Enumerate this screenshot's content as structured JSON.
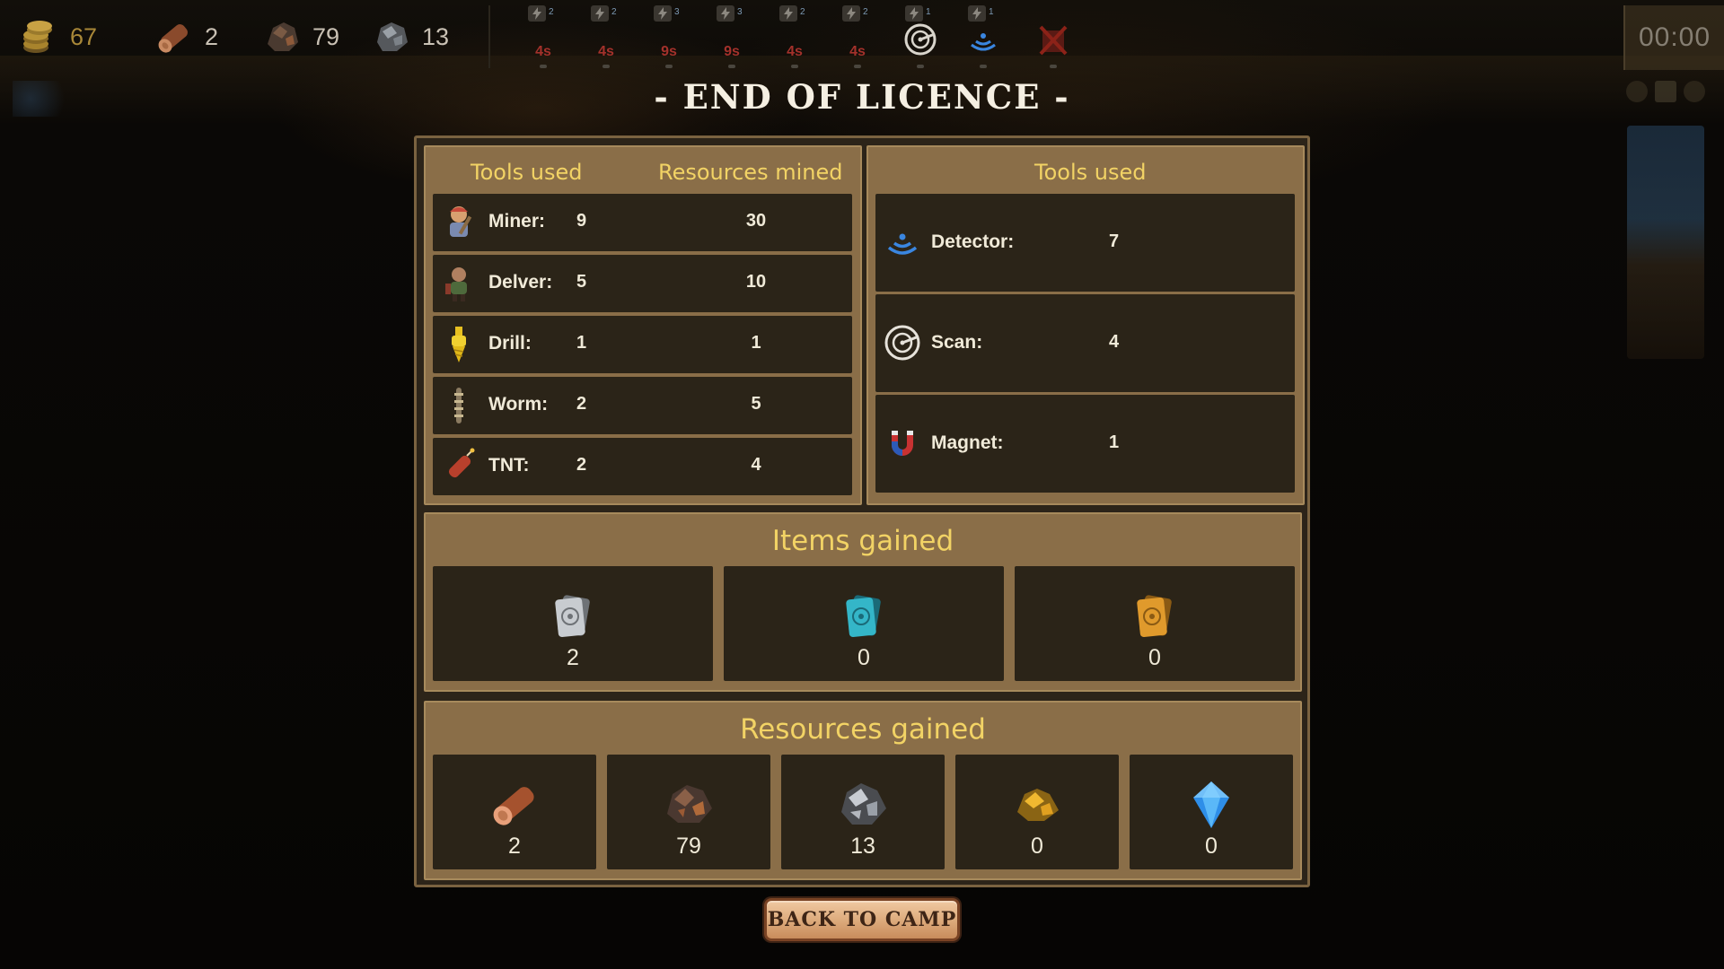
{
  "hud": {
    "resources": [
      {
        "name": "coins",
        "icon": "coins-icon",
        "value": "67"
      },
      {
        "name": "wood",
        "icon": "wood-log-icon",
        "value": "2"
      },
      {
        "name": "copper",
        "icon": "copper-ore-icon",
        "value": "79"
      },
      {
        "name": "iron",
        "icon": "iron-ore-icon",
        "value": "13"
      }
    ],
    "tool_slots": [
      {
        "count": "2",
        "cooldown": "4s"
      },
      {
        "count": "2",
        "cooldown": "4s"
      },
      {
        "count": "3",
        "cooldown": "9s"
      },
      {
        "count": "3",
        "cooldown": "9s"
      },
      {
        "count": "2",
        "cooldown": "4s"
      },
      {
        "count": "2",
        "cooldown": "4s"
      },
      {
        "count": "1",
        "icon": "scan-icon"
      },
      {
        "count": "1",
        "icon": "detector-icon"
      },
      {
        "icon": "disabled-tool-icon"
      }
    ],
    "timer": "00:00"
  },
  "dialog": {
    "title": "- END OF LICENCE -",
    "left_panel": {
      "col_tools": "Tools used",
      "col_resources": "Resources mined",
      "rows": [
        {
          "icon": "miner-icon",
          "name": "Miner:",
          "used": "9",
          "mined": "30"
        },
        {
          "icon": "delver-icon",
          "name": "Delver:",
          "used": "5",
          "mined": "10"
        },
        {
          "icon": "drill-icon",
          "name": "Drill:",
          "used": "1",
          "mined": "1"
        },
        {
          "icon": "worm-icon",
          "name": "Worm:",
          "used": "2",
          "mined": "5"
        },
        {
          "icon": "tnt-icon",
          "name": "TNT:",
          "used": "2",
          "mined": "4"
        }
      ]
    },
    "right_panel": {
      "col_tools": "Tools used",
      "rows": [
        {
          "icon": "detector-icon",
          "name": "Detector:",
          "used": "7"
        },
        {
          "icon": "scan-icon",
          "name": "Scan:",
          "used": "4"
        },
        {
          "icon": "magnet-icon",
          "name": "Magnet:",
          "used": "1"
        }
      ]
    },
    "items": {
      "title": "Items gained",
      "cards": [
        {
          "icon": "silver-card-icon",
          "value": "2",
          "color": "#c8ccd0"
        },
        {
          "icon": "cyan-card-icon",
          "value": "0",
          "color": "#34b6c8"
        },
        {
          "icon": "gold-card-icon",
          "value": "0",
          "color": "#e09a2c"
        }
      ]
    },
    "resources": {
      "title": "Resources gained",
      "cards": [
        {
          "icon": "wood-log-icon",
          "value": "2"
        },
        {
          "icon": "copper-ore-icon",
          "value": "79"
        },
        {
          "icon": "iron-ore-icon",
          "value": "13"
        },
        {
          "icon": "gold-ore-icon",
          "value": "0"
        },
        {
          "icon": "diamond-icon",
          "value": "0"
        }
      ]
    },
    "back_button": "BACK TO CAMP"
  },
  "colors": {
    "accent_yellow": "#f2d365",
    "panel": "#8a6e48",
    "cell": "#2b2418",
    "cooldown_red": "#a4312b"
  }
}
